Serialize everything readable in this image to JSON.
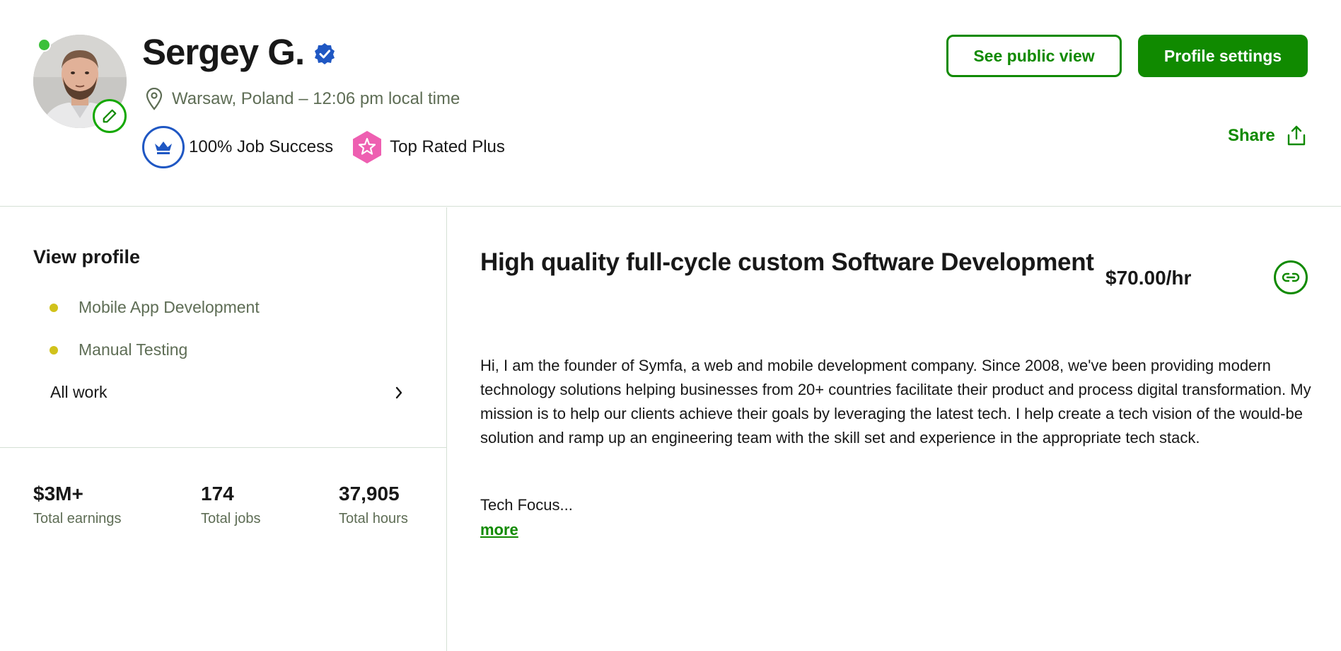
{
  "profile": {
    "name": "Sergey G.",
    "location": "Warsaw, Poland – 12:06 pm local time",
    "job_success": "100% Job Success",
    "top_rated": "Top Rated Plus",
    "online_status_color": "#3cc03a"
  },
  "header": {
    "see_public_view": "See public view",
    "profile_settings": "Profile settings",
    "share": "Share"
  },
  "sidebar": {
    "view_profile": "View profile",
    "specialized": [
      {
        "label": "Mobile App Development"
      },
      {
        "label": "Manual Testing"
      }
    ],
    "all_work": "All work",
    "stats": [
      {
        "value": "$3M+",
        "label": "Total earnings"
      },
      {
        "value": "174",
        "label": "Total jobs"
      },
      {
        "value": "37,905",
        "label": "Total hours"
      }
    ]
  },
  "main": {
    "title": "High quality full-cycle custom Software Development",
    "rate": "$70.00/hr",
    "description": "Hi, I am the founder of Symfa, a web and mobile development company. Since 2008, we've been providing modern technology solutions helping businesses from 20+ countries facilitate their product and process digital transformation. My mission is to help our clients achieve their goals by leveraging the latest tech. I help create a tech vision of the would-be solution and ramp up an engineering team with the skill set and experience in the appropriate tech stack.",
    "tech_focus": "Tech Focus...",
    "more": "more"
  },
  "colors": {
    "brand_green": "#108a00",
    "jss_blue": "#1f57c3",
    "top_rated_pink": "#ee5fb1",
    "specialty_dot": "#d1c21b"
  }
}
